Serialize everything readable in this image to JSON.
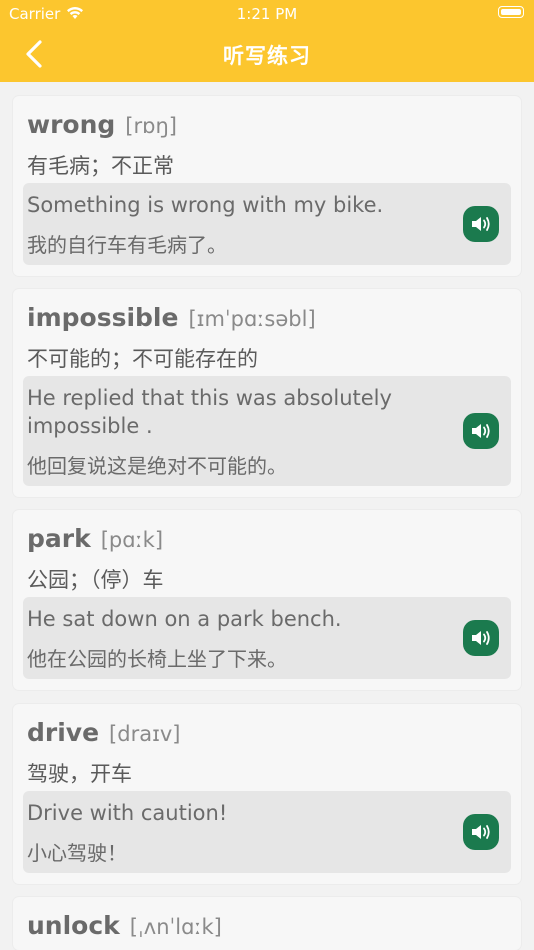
{
  "status_bar": {
    "carrier": "Carrier",
    "time": "1:21 PM"
  },
  "nav": {
    "title": "听写练习"
  },
  "colors": {
    "accent": "#fcc62e",
    "speaker": "#1b7a4e"
  },
  "words": [
    {
      "word": "wrong",
      "phonetic": "[rɒŋ]",
      "meaning": "有毛病；不正常",
      "example_en": "Something is wrong with my bike.",
      "example_zh": "我的自行车有毛病了。"
    },
    {
      "word": "impossible",
      "phonetic": "[ɪmˈpɑːsəbl]",
      "meaning": "不可能的；不可能存在的",
      "example_en": "He replied that this was absolutely impossible .",
      "example_zh": "他回复说这是绝对不可能的。"
    },
    {
      "word": "park",
      "phonetic": "[pɑːk]",
      "meaning": "公园；（停）车",
      "example_en": "He sat down on a park bench.",
      "example_zh": "他在公园的长椅上坐了下来。"
    },
    {
      "word": "drive",
      "phonetic": "[draɪv]",
      "meaning": "驾驶，开车",
      "example_en": "Drive with caution!",
      "example_zh": "小心驾驶！"
    },
    {
      "word": "unlock",
      "phonetic": "[ˌʌnˈlɑːk]"
    }
  ]
}
